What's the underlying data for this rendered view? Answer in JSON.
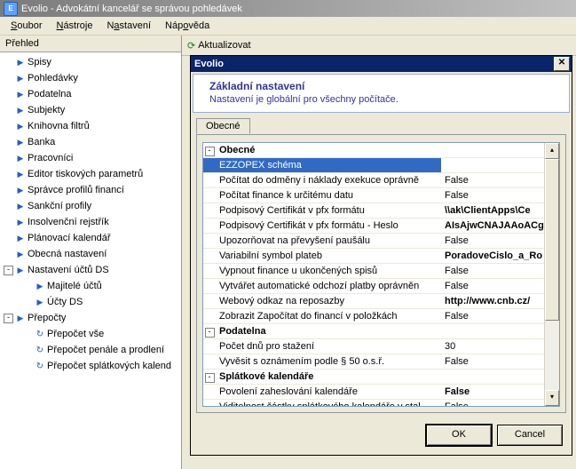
{
  "window": {
    "title": "Evolio - Advokátní kancelář se správou pohledávek"
  },
  "menu": {
    "soubor": "Soubor",
    "nastroje": "Nástroje",
    "nastaveni": "Nastavení",
    "napoveda": "Nápověda",
    "u": {
      "soubor": "S",
      "nastroje": "N",
      "nastaveni": "a",
      "napoveda": "o"
    }
  },
  "sidebar": {
    "header": "Přehled",
    "items": [
      {
        "label": "Spisy",
        "indent": 0,
        "icon": "play"
      },
      {
        "label": "Pohledávky",
        "indent": 0,
        "icon": "play"
      },
      {
        "label": "Podatelna",
        "indent": 0,
        "icon": "play"
      },
      {
        "label": "Subjekty",
        "indent": 0,
        "icon": "play"
      },
      {
        "label": "Knihovna filtrů",
        "indent": 0,
        "icon": "play"
      },
      {
        "label": "Banka",
        "indent": 0,
        "icon": "play"
      },
      {
        "label": "Pracovníci",
        "indent": 0,
        "icon": "play"
      },
      {
        "label": "Editor tiskových parametrů",
        "indent": 0,
        "icon": "play"
      },
      {
        "label": "Správce profilů financí",
        "indent": 0,
        "icon": "play"
      },
      {
        "label": "Sankční profily",
        "indent": 0,
        "icon": "play"
      },
      {
        "label": "Insolvenční rejstřík",
        "indent": 0,
        "icon": "play"
      },
      {
        "label": "Plánovací kalendář",
        "indent": 0,
        "icon": "play"
      },
      {
        "label": "Obecná nastavení",
        "indent": 0,
        "icon": "play"
      },
      {
        "label": "Nastavení účtů DS",
        "indent": 0,
        "icon": "play",
        "exp": "-"
      },
      {
        "label": "Majitelé účtů",
        "indent": 1,
        "icon": "play"
      },
      {
        "label": "Účty DS",
        "indent": 1,
        "icon": "play"
      },
      {
        "label": "Přepočty",
        "indent": 0,
        "icon": "play",
        "exp": "-"
      },
      {
        "label": "Přepočet vše",
        "indent": 1,
        "icon": "refresh"
      },
      {
        "label": "Přepočet penále a prodlení",
        "indent": 1,
        "icon": "refresh"
      },
      {
        "label": "Přepočet splátkových kalend",
        "indent": 1,
        "icon": "refresh"
      }
    ]
  },
  "toolbar": {
    "refresh": "Aktualizovat"
  },
  "dialog": {
    "title": "Evolio",
    "banner_title": "Základní nastavení",
    "banner_sub": "Nastavení je globální pro všechny počítače.",
    "tab": "Obecné",
    "buttons": {
      "ok": "OK",
      "cancel": "Cancel"
    },
    "grid": [
      {
        "section": true,
        "toggle": "-",
        "name": "Obecné"
      },
      {
        "name": "EZZOPEX schéma",
        "value": "",
        "selected": true
      },
      {
        "name": "Počítat do odměny i náklady exekuce oprávně",
        "value": "False"
      },
      {
        "name": "Počítat finance k určitému datu",
        "value": "False"
      },
      {
        "name": "Podpisový Certifikát v pfx formátu",
        "value": "\\\\ak\\ClientApps\\Ce",
        "bold": true
      },
      {
        "name": "Podpisový Certifikát v pfx formátu - Heslo",
        "value": "AIsAjwCNAJAAoACg",
        "bold": true
      },
      {
        "name": "Upozorňovat na převyšení paušálu",
        "value": "False"
      },
      {
        "name": "Variabilní symbol plateb",
        "value": "PoradoveCislo_a_Ro",
        "bold": true
      },
      {
        "name": "Vypnout finance u ukončených spisů",
        "value": "False"
      },
      {
        "name": "Vytvářet automatické odchozí platby oprávněn",
        "value": "False"
      },
      {
        "name": "Webový odkaz na reposazby",
        "value": "http://www.cnb.cz/",
        "bold": true
      },
      {
        "name": "Zobrazit Započítat do financí v položkách",
        "value": "False"
      },
      {
        "section": true,
        "toggle": "-",
        "name": "Podatelna"
      },
      {
        "name": "Počet dnů pro stažení",
        "value": "30"
      },
      {
        "name": "Vyvěsit s oznámením podle § 50 o.s.ř.",
        "value": "False"
      },
      {
        "section": true,
        "toggle": "-",
        "name": "Splátkové kalendáře"
      },
      {
        "name": "Povolení zaheslování kalendáře",
        "value": "False",
        "bold": true
      },
      {
        "name": "Viditelnost částky splátkového kalendáře v stal",
        "value": "False"
      }
    ]
  }
}
